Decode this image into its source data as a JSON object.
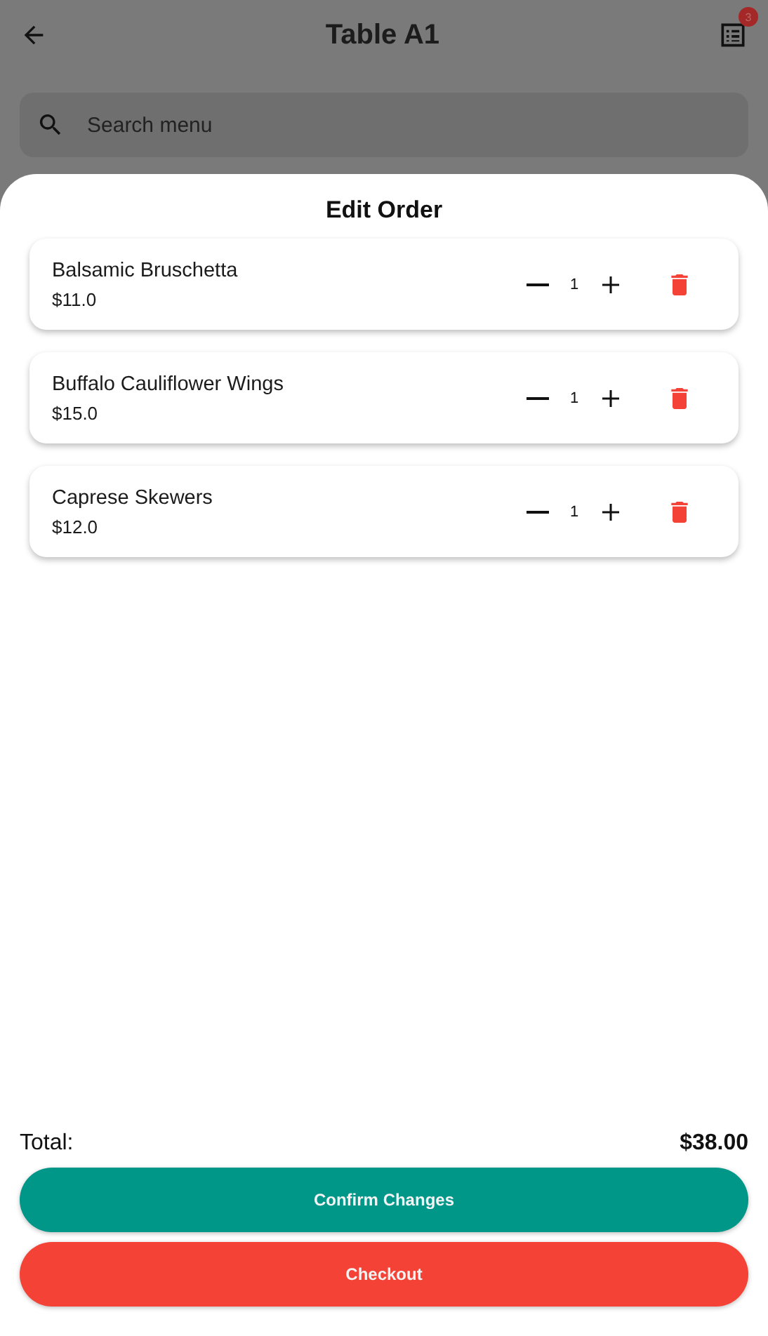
{
  "app_bar": {
    "title": "Table A1",
    "badge": "3"
  },
  "search": {
    "placeholder": "Search menu"
  },
  "sheet": {
    "title": "Edit Order",
    "items": [
      {
        "name": "Balsamic Bruschetta",
        "price": "$11.0",
        "quantity": "1"
      },
      {
        "name": "Buffalo Cauliflower Wings",
        "price": "$15.0",
        "quantity": "1"
      },
      {
        "name": "Caprese Skewers",
        "price": "$12.0",
        "quantity": "1"
      }
    ],
    "total_label": "Total:",
    "total_value": "$38.00",
    "buttons": [
      {
        "label": "Confirm Changes",
        "kind": "confirm"
      },
      {
        "label": "Checkout",
        "kind": "checkout"
      }
    ]
  }
}
